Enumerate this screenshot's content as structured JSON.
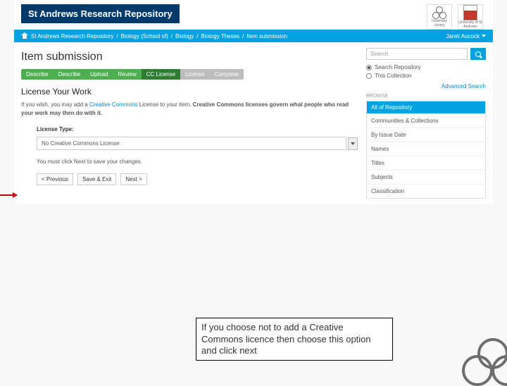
{
  "brand": "St Andrews Research Repository",
  "logos": {
    "library": "University Library",
    "uni": "University of St Andrews"
  },
  "breadcrumb": {
    "items": [
      "St Andrews Research Repository",
      "Biology (School of)",
      "Biology",
      "Biology Theses",
      "Item submission"
    ]
  },
  "user": {
    "name": "Janet Aucock"
  },
  "page_title": "Item submission",
  "steps": [
    {
      "label": "Describe",
      "state": "done"
    },
    {
      "label": "Describe",
      "state": "done"
    },
    {
      "label": "Upload",
      "state": "done"
    },
    {
      "label": "Review",
      "state": "done"
    },
    {
      "label": "CC License",
      "state": "active"
    },
    {
      "label": "License",
      "state": "pending"
    },
    {
      "label": "Complete",
      "state": "pending"
    }
  ],
  "section_title": "License Your Work",
  "intro_prefix": "If you wish, you may add a ",
  "intro_link": "Creative Commons",
  "intro_mid": " License to your item. ",
  "intro_bold": "Creative Commons licenses govern what people who read your work may then do with it.",
  "license_label": "License Type:",
  "license_select_value": "No Creative Commons License",
  "hint": "You must click Next to save your changes.",
  "buttons": {
    "prev": "< Previous",
    "save": "Save & Exit",
    "next": "Next >"
  },
  "search": {
    "placeholder": "Search",
    "scope_repo": "Search Repository",
    "scope_coll": "This Collection",
    "advanced": "Advanced Search"
  },
  "browse": {
    "heading": "BROWSE",
    "panel_title": "All of Repository",
    "items": [
      "Communities & Collections",
      "By Issue Date",
      "Names",
      "Titles",
      "Subjects",
      "Classification"
    ]
  },
  "callout": "If you choose not to add a Creative Commons licence then choose this option and click next"
}
